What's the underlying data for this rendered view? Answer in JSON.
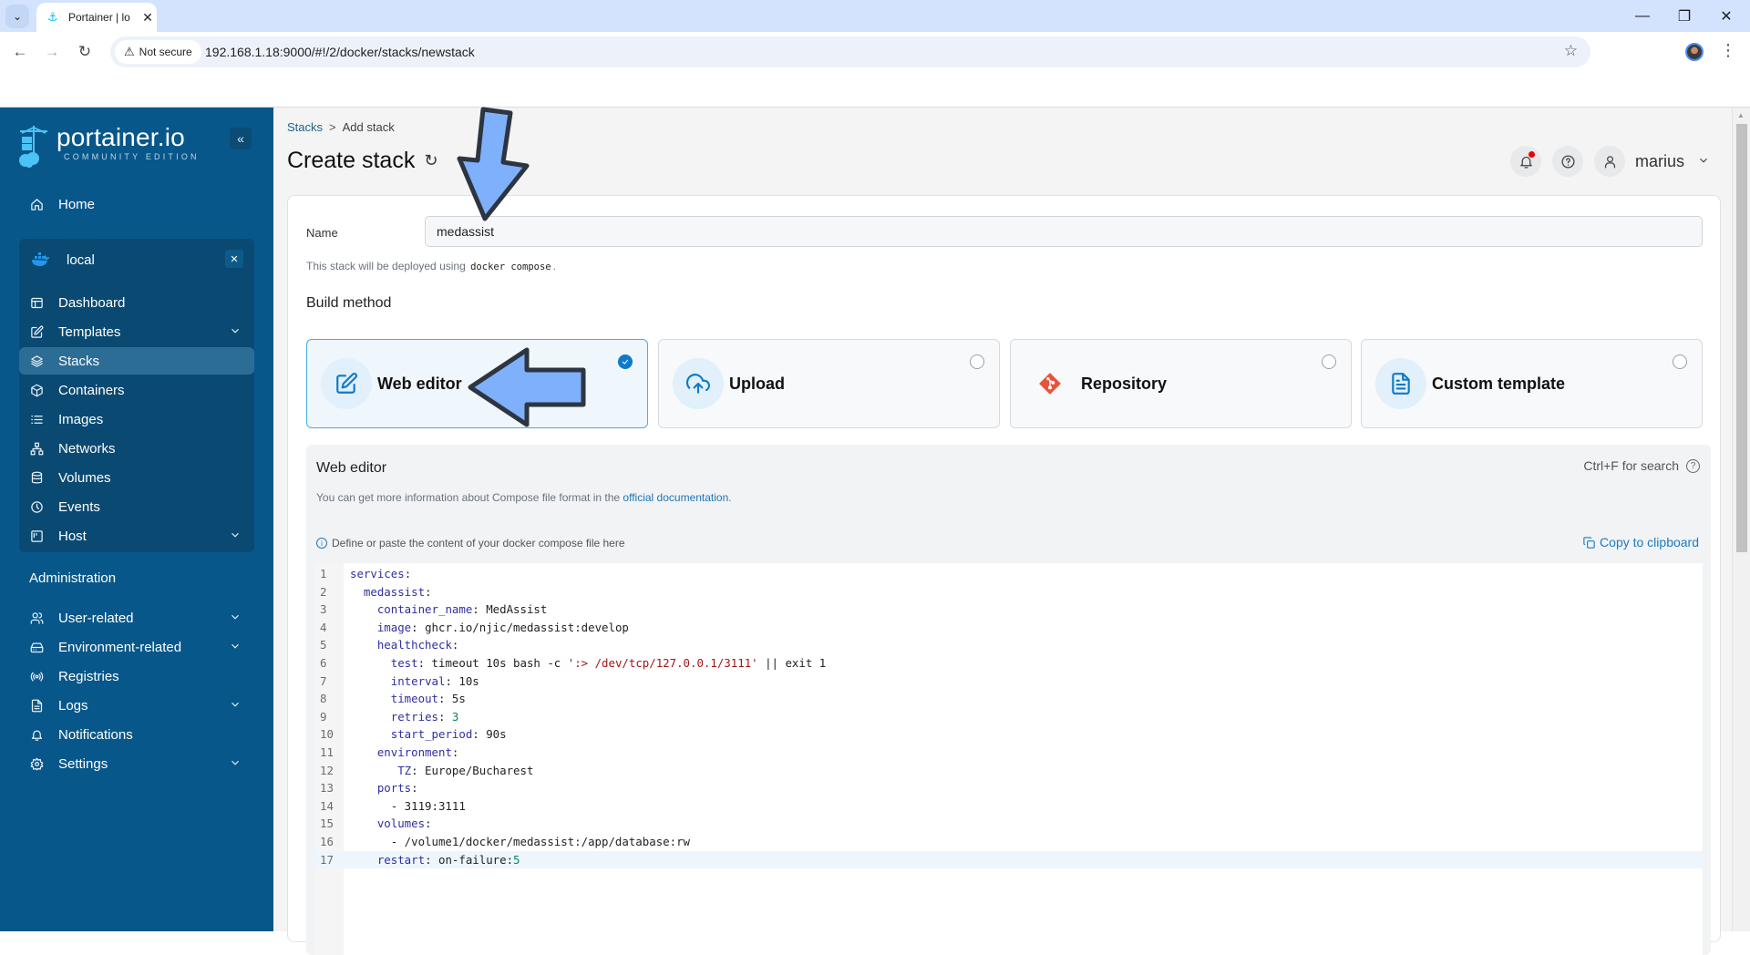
{
  "browser": {
    "tab_title": "Portainer | lo",
    "security_label": "Not secure",
    "url": "192.168.1.18:9000/#!/2/docker/stacks/newstack"
  },
  "sidebar": {
    "brand_name": "portainer.io",
    "brand_edition": "COMMUNITY EDITION",
    "home_label": "Home",
    "environment": {
      "name": "local",
      "items": [
        {
          "label": "Dashboard",
          "icon": "dashboard-icon",
          "expandable": false,
          "active": false
        },
        {
          "label": "Templates",
          "icon": "templates-icon",
          "expandable": true,
          "active": false
        },
        {
          "label": "Stacks",
          "icon": "stacks-icon",
          "expandable": false,
          "active": true
        },
        {
          "label": "Containers",
          "icon": "containers-icon",
          "expandable": false,
          "active": false
        },
        {
          "label": "Images",
          "icon": "images-icon",
          "expandable": false,
          "active": false
        },
        {
          "label": "Networks",
          "icon": "networks-icon",
          "expandable": false,
          "active": false
        },
        {
          "label": "Volumes",
          "icon": "volumes-icon",
          "expandable": false,
          "active": false
        },
        {
          "label": "Events",
          "icon": "events-icon",
          "expandable": false,
          "active": false
        },
        {
          "label": "Host",
          "icon": "host-icon",
          "expandable": true,
          "active": false
        }
      ]
    },
    "admin_title": "Administration",
    "admin_items": [
      {
        "label": "User-related",
        "icon": "users-icon",
        "expandable": true
      },
      {
        "label": "Environment-related",
        "icon": "environment-icon",
        "expandable": true
      },
      {
        "label": "Registries",
        "icon": "registries-icon",
        "expandable": false
      },
      {
        "label": "Logs",
        "icon": "logs-icon",
        "expandable": true
      },
      {
        "label": "Notifications",
        "icon": "bell-icon",
        "expandable": false
      },
      {
        "label": "Settings",
        "icon": "settings-icon",
        "expandable": true
      }
    ]
  },
  "header": {
    "breadcrumb": [
      "Stacks",
      "Add stack"
    ],
    "breadcrumb_sep": ">",
    "title": "Create stack",
    "username": "marius",
    "has_notification": true
  },
  "form": {
    "name_label": "Name",
    "name_value": "medassist",
    "deploy_note_prefix": "This stack will be deployed using",
    "deploy_note_code": "docker compose",
    "deploy_note_suffix": ".",
    "build_method_title": "Build method",
    "build_methods": [
      {
        "label": "Web editor",
        "icon": "edit-icon",
        "selected": true
      },
      {
        "label": "Upload",
        "icon": "upload-cloud-icon",
        "selected": false
      },
      {
        "label": "Repository",
        "icon": "git-icon",
        "selected": false
      },
      {
        "label": "Custom template",
        "icon": "file-text-icon",
        "selected": false
      }
    ]
  },
  "editor": {
    "title": "Web editor",
    "search_hint": "Ctrl+F for search",
    "info_prefix": "You can get more information about Compose file format in the",
    "info_link": "official documentation",
    "info_suffix": ".",
    "define_note": "Define or paste the content of your docker compose file here",
    "copy_label": "Copy to clipboard",
    "active_line": 17,
    "lines": [
      "services:",
      "  medassist:",
      "    container_name: MedAssist",
      "    image: ghcr.io/njic/medassist:develop",
      "    healthcheck:",
      "      test: timeout 10s bash -c ':> /dev/tcp/127.0.0.1/3111' || exit 1",
      "      interval: 10s",
      "      timeout: 5s",
      "      retries: 3",
      "      start_period: 90s",
      "    environment:",
      "       TZ: Europe/Bucharest",
      "    ports:",
      "      - 3119:3111",
      "    volumes:",
      "      - /volume1/docker/medassist:/app/database:rw",
      "    restart: on-failure:5"
    ]
  },
  "colors": {
    "sidebar_bg": "#08578a",
    "accent": "#0f7ac7",
    "annotation_arrow": "#7eb0fb"
  }
}
